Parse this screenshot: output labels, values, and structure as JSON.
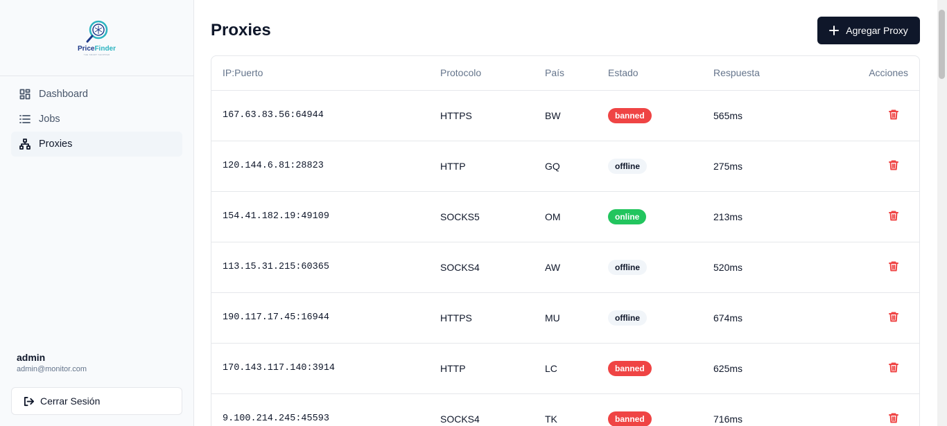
{
  "brand": {
    "name_part1": "Price",
    "name_part2": "Finder",
    "tagline": "THE SMART SHOPPER"
  },
  "nav": {
    "items": [
      {
        "label": "Dashboard",
        "icon": "dashboard-icon",
        "active": false
      },
      {
        "label": "Jobs",
        "icon": "list-icon",
        "active": false
      },
      {
        "label": "Proxies",
        "icon": "network-icon",
        "active": true
      }
    ]
  },
  "user": {
    "name": "admin",
    "email": "admin@monitor.com",
    "logout_label": "Cerrar Sesión"
  },
  "page": {
    "title": "Proxies",
    "add_button_label": "Agregar Proxy"
  },
  "table": {
    "headers": {
      "ip": "IP:Puerto",
      "protocol": "Protocolo",
      "country": "País",
      "status": "Estado",
      "response": "Respuesta",
      "actions": "Acciones"
    },
    "rows": [
      {
        "ip": "167.63.83.56:64944",
        "protocol": "HTTPS",
        "country": "BW",
        "status": "banned",
        "response": "565ms"
      },
      {
        "ip": "120.144.6.81:28823",
        "protocol": "HTTP",
        "country": "GQ",
        "status": "offline",
        "response": "275ms"
      },
      {
        "ip": "154.41.182.19:49109",
        "protocol": "SOCKS5",
        "country": "OM",
        "status": "online",
        "response": "213ms"
      },
      {
        "ip": "113.15.31.215:60365",
        "protocol": "SOCKS4",
        "country": "AW",
        "status": "offline",
        "response": "520ms"
      },
      {
        "ip": "190.117.17.45:16944",
        "protocol": "HTTPS",
        "country": "MU",
        "status": "offline",
        "response": "674ms"
      },
      {
        "ip": "170.143.117.140:3914",
        "protocol": "HTTP",
        "country": "LC",
        "status": "banned",
        "response": "625ms"
      },
      {
        "ip": "9.100.214.245:45593",
        "protocol": "SOCKS4",
        "country": "TK",
        "status": "banned",
        "response": "716ms"
      }
    ]
  },
  "colors": {
    "primary": "#0f172a",
    "banned": "#ef4444",
    "online": "#22c55e",
    "offline_bg": "#f1f5f9"
  }
}
